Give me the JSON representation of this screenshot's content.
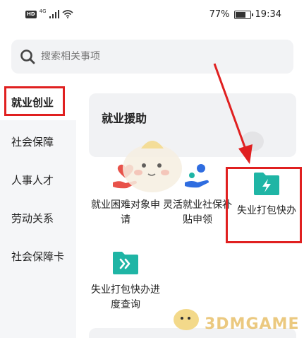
{
  "status_bar": {
    "hd": "HD",
    "network": "4G",
    "battery_text": "77%",
    "battery_level": 0.77,
    "time": "19:34"
  },
  "search": {
    "placeholder": "搜索相关事项"
  },
  "sidebar": {
    "items": [
      {
        "label": "就业创业",
        "active": true
      },
      {
        "label": "社会保障",
        "active": false
      },
      {
        "label": "人事人才",
        "active": false
      },
      {
        "label": "劳动关系",
        "active": false
      },
      {
        "label": "社会保障卡",
        "active": false
      }
    ]
  },
  "main": {
    "section_title": "就业援助",
    "services": [
      {
        "label": "就业困难对象申请",
        "icon": "heart-hand-icon"
      },
      {
        "label": "灵活就业社保补贴申领",
        "icon": "person-hand-icon"
      },
      {
        "label": "失业打包快办",
        "icon": "folder-lightning-icon"
      },
      {
        "label": "失业打包快办进度查询",
        "icon": "folder-forward-icon"
      }
    ]
  },
  "watermark": "3DMGAME",
  "colors": {
    "accent_teal": "#1fb5a5",
    "heart_red": "#e8524a",
    "blue": "#2f6de0",
    "annotation_red": "#e02020",
    "sidebar_bg": "#f5f6f8"
  }
}
